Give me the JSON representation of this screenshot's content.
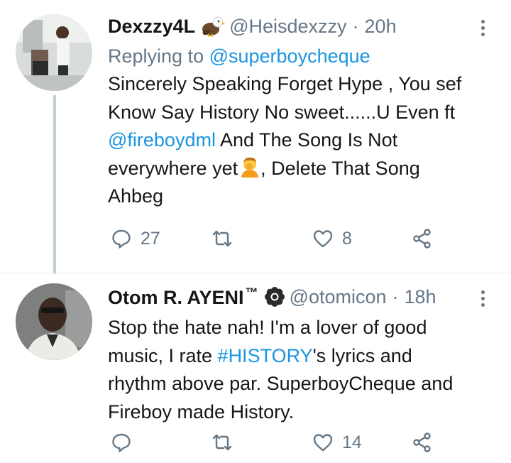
{
  "tweets": [
    {
      "display_name": "Dexzzy4L",
      "badge_icon": "eagle-emoji",
      "handle": "@Heisdexzzy",
      "separator": "·",
      "time": "20h",
      "replying_prefix": "Replying to ",
      "replying_to": "@superboycheque",
      "body": {
        "line1": "Sincerely Speaking Forget Hype , You sef",
        "line2": "Know Say History No sweet......U Even ft",
        "mention": "@fireboydml",
        "line3_rest": " And The Song Is Not",
        "line4_start": "everywhere yet",
        "emoji": "person-facepalming-emoji",
        "line4_rest": ", Delete That Song",
        "line5": "Ahbeg"
      },
      "actions": {
        "reply_count": "27",
        "retweet_count": "",
        "like_count": "8"
      }
    },
    {
      "display_name": "Otom R. AYENI",
      "name_suffix": "™",
      "badge_icon": "flower-emoji",
      "handle": "@otomicon",
      "separator": "·",
      "time": "18h",
      "body": {
        "line1": "Stop the hate nah! I'm a lover of good",
        "line2_start": "music, I rate ",
        "hashtag": "#HISTORY",
        "line2_rest": "'s lyrics and",
        "line3": "rhythm above par. SuperboyCheque and",
        "line4": "Fireboy made History."
      },
      "actions": {
        "reply_count": "",
        "retweet_count": "",
        "like_count": "14"
      }
    }
  ],
  "colors": {
    "text": "#14171a",
    "muted": "#657786",
    "link": "#1b95e0",
    "thread_line": "#c4cfd6"
  }
}
